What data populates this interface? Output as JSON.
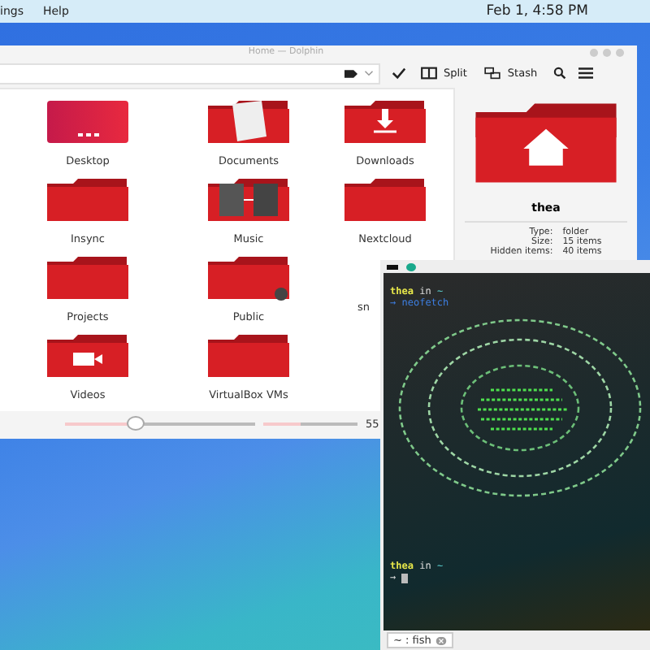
{
  "panel": {
    "menu": [
      "ings",
      "Help"
    ],
    "clock": "Feb 1, 4:58 PM"
  },
  "dolphin": {
    "title": "Home — Dolphin",
    "toolbar": {
      "split": "Split",
      "stash": "Stash"
    },
    "files": [
      {
        "name": "Desktop",
        "kind": "desktop"
      },
      {
        "name": "Documents",
        "kind": "documents"
      },
      {
        "name": "Downloads",
        "kind": "downloads"
      },
      {
        "name": "Insync",
        "kind": "plain"
      },
      {
        "name": "Music",
        "kind": "music"
      },
      {
        "name": "Nextcloud",
        "kind": "plain"
      },
      {
        "name": "Projects",
        "kind": "plain"
      },
      {
        "name": "Public",
        "kind": "shared"
      },
      {
        "name": "sn",
        "kind": "covered"
      },
      {
        "name": "Videos",
        "kind": "videos"
      },
      {
        "name": "VirtualBox VMs",
        "kind": "plain"
      }
    ],
    "info": {
      "name": "thea",
      "properties": [
        {
          "label": "Type:",
          "value": "folder"
        },
        {
          "label": "Size:",
          "value": "15 items"
        },
        {
          "label": "Hidden items:",
          "value": "40 items"
        }
      ]
    },
    "status": {
      "zoom": {
        "level": 0.38
      },
      "space": {
        "level": 0.4
      },
      "reading": "55"
    }
  },
  "terminal": {
    "lines": [
      {
        "kind": "prompt",
        "user": "thea",
        "word": "in",
        "dir": "~"
      },
      {
        "kind": "command",
        "arrow": "→",
        "text": "neofetch"
      },
      {
        "kind": "art"
      },
      {
        "kind": "prompt",
        "user": "thea",
        "word": "in",
        "dir": "~"
      },
      {
        "kind": "cursor",
        "arrow": "→"
      }
    ],
    "tab": "~ : fish"
  }
}
